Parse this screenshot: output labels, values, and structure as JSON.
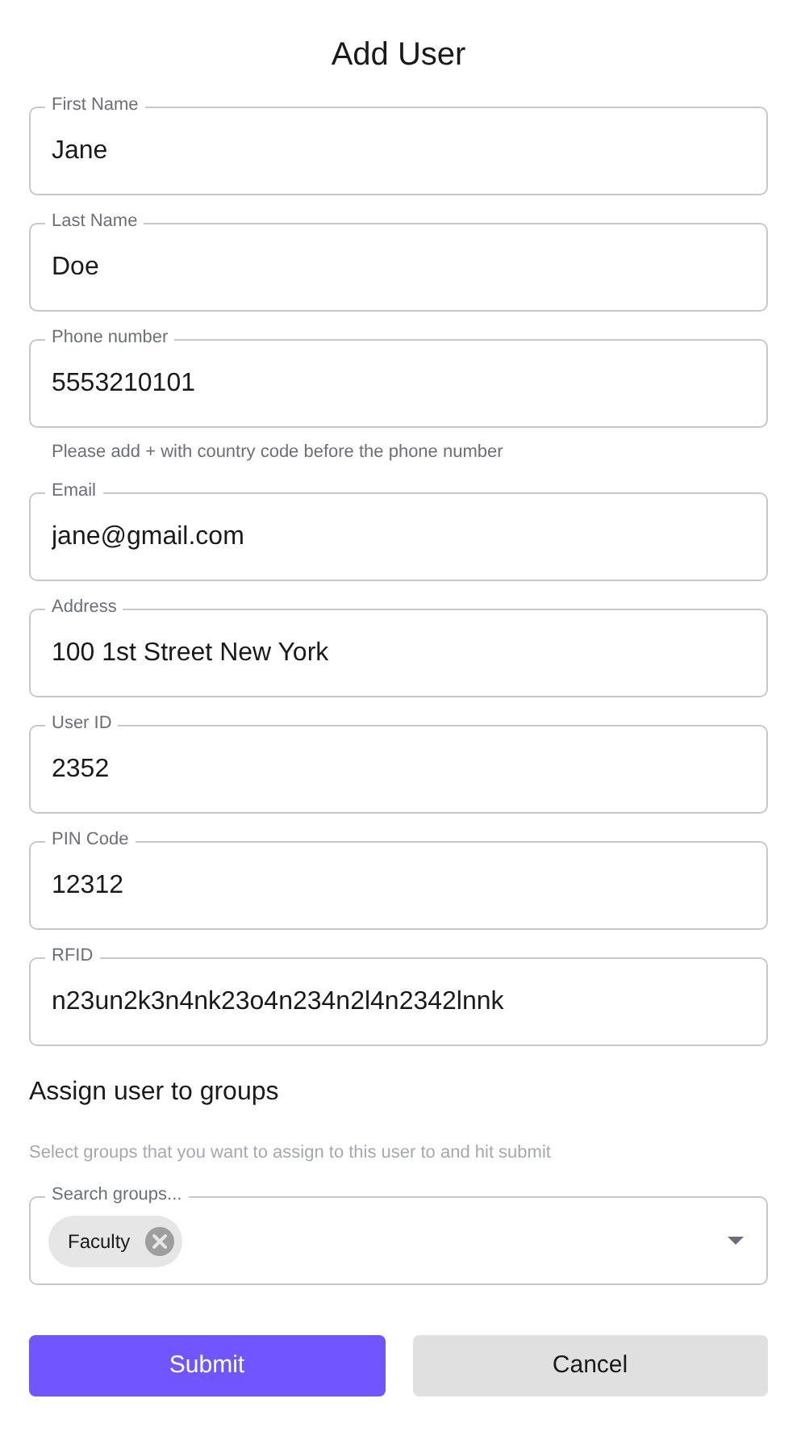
{
  "title": "Add User",
  "fields": [
    {
      "label": "First Name",
      "value": "Jane"
    },
    {
      "label": "Last Name",
      "value": "Doe"
    },
    {
      "label": "Phone number",
      "value": "5553210101",
      "helper": "Please add + with country code before the phone number"
    },
    {
      "label": "Email",
      "value": "jane@gmail.com"
    },
    {
      "label": "Address",
      "value": "100 1st Street New York"
    },
    {
      "label": "User ID",
      "value": "2352"
    },
    {
      "label": "PIN Code",
      "value": "12312"
    },
    {
      "label": "RFID",
      "value": "n23un2k3n4nk23o4n234n2l4n2342lnnk"
    }
  ],
  "groups": {
    "heading": "Assign user to groups",
    "description": "Select groups that you want to assign to this user to and hit submit",
    "search": {
      "label": "Search groups...",
      "chips": [
        {
          "label": "Faculty"
        }
      ]
    }
  },
  "buttons": [
    {
      "label": "Submit",
      "kind": "primary"
    },
    {
      "label": "Cancel",
      "kind": "secondary"
    }
  ]
}
